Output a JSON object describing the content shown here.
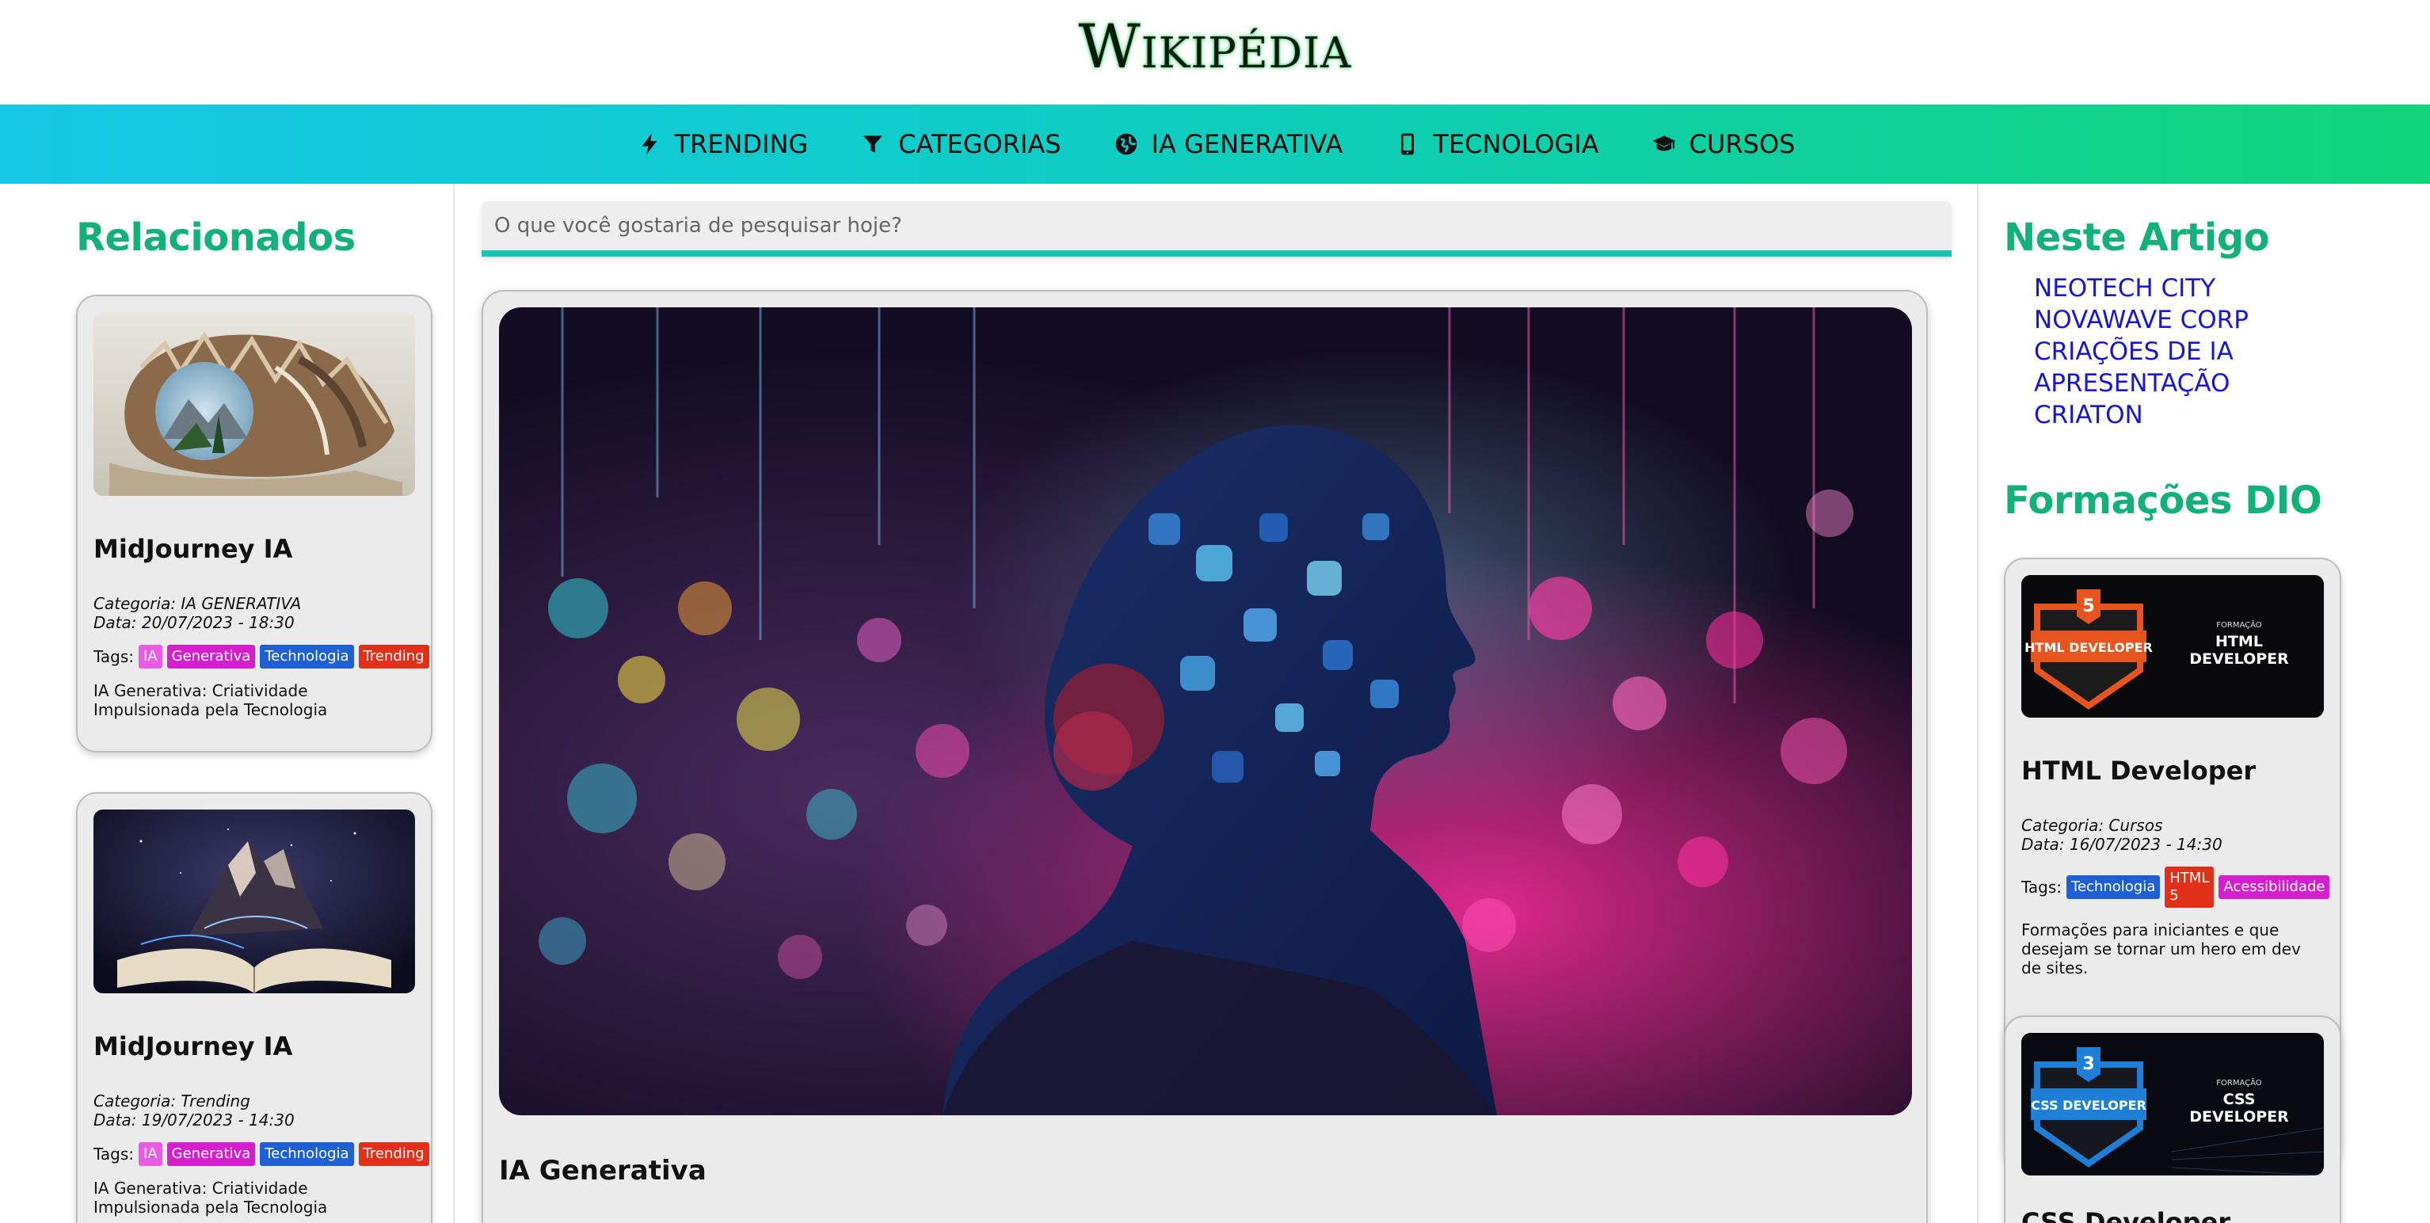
{
  "header": {
    "logo": "Wikipédia"
  },
  "nav": [
    {
      "icon": "bolt-icon",
      "label": "TRENDING"
    },
    {
      "icon": "filter-icon",
      "label": "CATEGORIAS"
    },
    {
      "icon": "globe-icon",
      "label": "IA GENERATIVA"
    },
    {
      "icon": "phone-icon",
      "label": "TECNOLOGIA"
    },
    {
      "icon": "graduation-cap-icon",
      "label": "CURSOS"
    }
  ],
  "left": {
    "title": "Relacionados",
    "cards": [
      {
        "title": "MidJourney IA",
        "category": "Categoria: IA GENERATIVA",
        "date": "Data: 20/07/2023 - 18:30",
        "tags_label": "Tags:",
        "tags": [
          {
            "label": "IA",
            "color": "#e85ce0"
          },
          {
            "label": "Generativa",
            "color": "#d51fcf"
          },
          {
            "label": "Technologia",
            "color": "#1f5fd6"
          },
          {
            "label": "Trending",
            "color": "#e0301a"
          }
        ],
        "description": "IA Generativa: Criatividade Impulsionada pela Tecnologia"
      },
      {
        "title": "MidJourney IA",
        "category": "Categoria: Trending",
        "date": "Data: 19/07/2023 - 14:30",
        "tags_label": "Tags:",
        "tags": [
          {
            "label": "IA",
            "color": "#e85ce0"
          },
          {
            "label": "Generativa",
            "color": "#d51fcf"
          },
          {
            "label": "Technologia",
            "color": "#1f5fd6"
          },
          {
            "label": "Trending",
            "color": "#e0301a"
          }
        ],
        "description": "IA Generativa: Criatividade Impulsionada pela Tecnologia"
      }
    ]
  },
  "search": {
    "placeholder": "O que você gostaria de pesquisar hoje?"
  },
  "article": {
    "title": "IA Generativa"
  },
  "right": {
    "toc_title": "Neste Artigo",
    "toc": [
      "NEOTECH CITY",
      "NOVAWAVE CORP",
      "CRIAÇÕES DE IA",
      "APRESENTAÇÃO",
      "CRIATON"
    ],
    "courses_title": "Formações DIO",
    "courses": [
      {
        "banner_small": "FORMAÇÃO",
        "banner_big": "HTML DEVELOPER",
        "badge_text": "HTML DEVELOPER",
        "badge_number": "5",
        "badge_color": "#e8541d",
        "title": "HTML Developer",
        "category": "Categoria: Cursos",
        "date": "Data: 16/07/2023 - 14:30",
        "tags_label": "Tags:",
        "tags": [
          {
            "label": "Technologia",
            "color": "#1f5fd6"
          },
          {
            "label": "HTML 5",
            "color": "#e0301a"
          },
          {
            "label": "Acessibilidade",
            "color": "#d51fcf"
          }
        ],
        "description": "Formações para iniciantes e que desejam se tornar um hero em dev de sites."
      },
      {
        "banner_small": "FORMAÇÃO",
        "banner_big": "CSS DEVELOPER",
        "badge_text": "CSS DEVELOPER",
        "badge_number": "3",
        "badge_color": "#1f7fd6",
        "title": "CSS Developer"
      }
    ]
  },
  "colors": {
    "accent": "#14b07a",
    "nav_start": "#17c7e6",
    "nav_end": "#10d478",
    "link": "#1a16cc"
  }
}
